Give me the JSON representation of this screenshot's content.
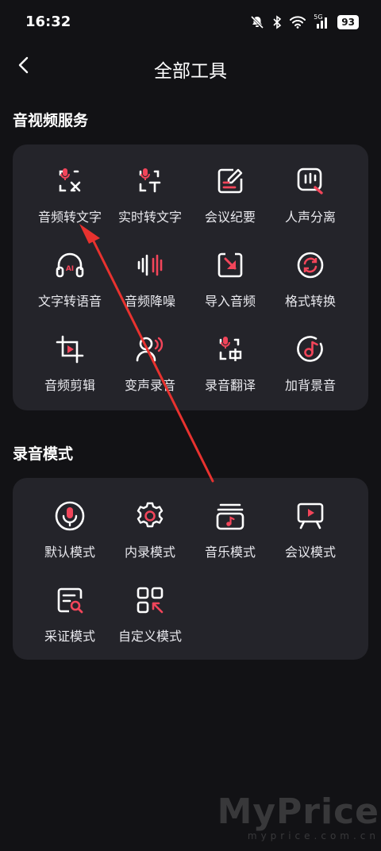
{
  "status_bar": {
    "time": "16:32",
    "network": "5G",
    "battery": "93"
  },
  "header": {
    "title": "全部工具",
    "back_icon": "chevron-left-icon"
  },
  "sections": [
    {
      "title": "音视频服务",
      "tools": [
        {
          "label": "音频转文字",
          "icon": "audio-to-text-icon"
        },
        {
          "label": "实时转文字",
          "icon": "realtime-transcribe-icon"
        },
        {
          "label": "会议纪要",
          "icon": "meeting-notes-icon"
        },
        {
          "label": "人声分离",
          "icon": "voice-separation-icon"
        },
        {
          "label": "文字转语音",
          "icon": "text-to-speech-icon"
        },
        {
          "label": "音频降噪",
          "icon": "noise-reduction-icon"
        },
        {
          "label": "导入音频",
          "icon": "import-audio-icon"
        },
        {
          "label": "格式转换",
          "icon": "format-convert-icon"
        },
        {
          "label": "音频剪辑",
          "icon": "audio-crop-icon"
        },
        {
          "label": "变声录音",
          "icon": "voice-changer-icon"
        },
        {
          "label": "录音翻译",
          "icon": "recording-translate-icon"
        },
        {
          "label": "加背景音",
          "icon": "add-background-music-icon"
        }
      ]
    },
    {
      "title": "录音模式",
      "tools": [
        {
          "label": "默认模式",
          "icon": "microphone-icon"
        },
        {
          "label": "内录模式",
          "icon": "gear-icon"
        },
        {
          "label": "音乐模式",
          "icon": "music-stack-icon"
        },
        {
          "label": "会议模式",
          "icon": "presentation-icon"
        },
        {
          "label": "采证模式",
          "icon": "evidence-search-icon"
        },
        {
          "label": "自定义模式",
          "icon": "custom-grid-icon"
        }
      ]
    }
  ],
  "colors": {
    "background": "#121215",
    "card": "#24242a",
    "accent": "#f2455a",
    "icon": "#ffffff"
  },
  "watermark": {
    "brand": "MyPrice",
    "domain": "myprice.com.cn"
  }
}
